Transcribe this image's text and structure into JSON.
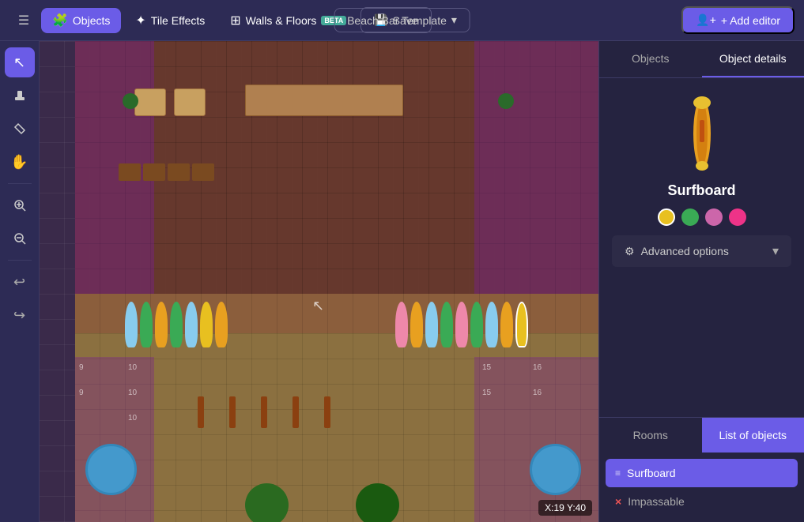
{
  "nav": {
    "hamburger_label": "☰",
    "objects_label": "Objects",
    "tile_effects_label": "Tile Effects",
    "walls_floors_label": "Walls & Floors",
    "beta_label": "BETA",
    "save_label": "Save",
    "template_label": "Beach Bar Template",
    "add_editor_label": "+ Add editor"
  },
  "left_tools": [
    {
      "id": "select",
      "icon": "↖",
      "label": "select-tool",
      "active": true
    },
    {
      "id": "stamp",
      "icon": "🖊",
      "label": "stamp-tool",
      "active": false
    },
    {
      "id": "erase",
      "icon": "◇",
      "label": "erase-tool",
      "active": false
    },
    {
      "id": "hand",
      "icon": "✋",
      "label": "hand-tool",
      "active": false
    },
    {
      "id": "zoom-in",
      "icon": "⊕",
      "label": "zoom-in-tool",
      "active": false
    },
    {
      "id": "zoom-out",
      "icon": "⊖",
      "label": "zoom-out-tool",
      "active": false
    },
    {
      "id": "undo",
      "icon": "↩",
      "label": "undo-tool",
      "active": false
    },
    {
      "id": "redo",
      "icon": "↪",
      "label": "redo-tool",
      "active": false
    }
  ],
  "right_panel": {
    "tab_objects": "Objects",
    "tab_object_details": "Object details",
    "active_tab": "Object details",
    "object": {
      "name": "Surfboard",
      "colors": [
        {
          "id": "yellow",
          "hex": "#e8c020",
          "selected": true
        },
        {
          "id": "green",
          "hex": "#3aaa55",
          "selected": false
        },
        {
          "id": "pink",
          "hex": "#cc66aa",
          "selected": false
        },
        {
          "id": "hotpink",
          "hex": "#ee3388",
          "selected": false
        }
      ]
    },
    "advanced_options_label": "Advanced options",
    "bottom_tab_rooms": "Rooms",
    "bottom_tab_list": "List of objects",
    "active_bottom_tab": "List of objects",
    "list_items": [
      {
        "id": "surfboard",
        "label": "Surfboard",
        "highlighted": true
      },
      {
        "id": "impassable",
        "label": "Impassable",
        "highlighted": false,
        "prefix": "×"
      }
    ]
  },
  "coord_display": "X:19  Y:40",
  "canvas": {
    "surfboard_colors": [
      "#e8c020",
      "#3aaa55",
      "#88ccee",
      "#3aaa55",
      "#e8a020",
      "#3aaa55",
      "#ee88aa",
      "#3aaa55",
      "#ee88aa",
      "#3aaa55",
      "#88ccee",
      "#3aaa55"
    ],
    "surfboard_colors_right": [
      "#ee88aa",
      "#e8a020",
      "#88ccee",
      "#3aaa55",
      "#ee88aa",
      "#3aaa55",
      "#88ccee",
      "#e8a020",
      "#e8c020"
    ]
  }
}
